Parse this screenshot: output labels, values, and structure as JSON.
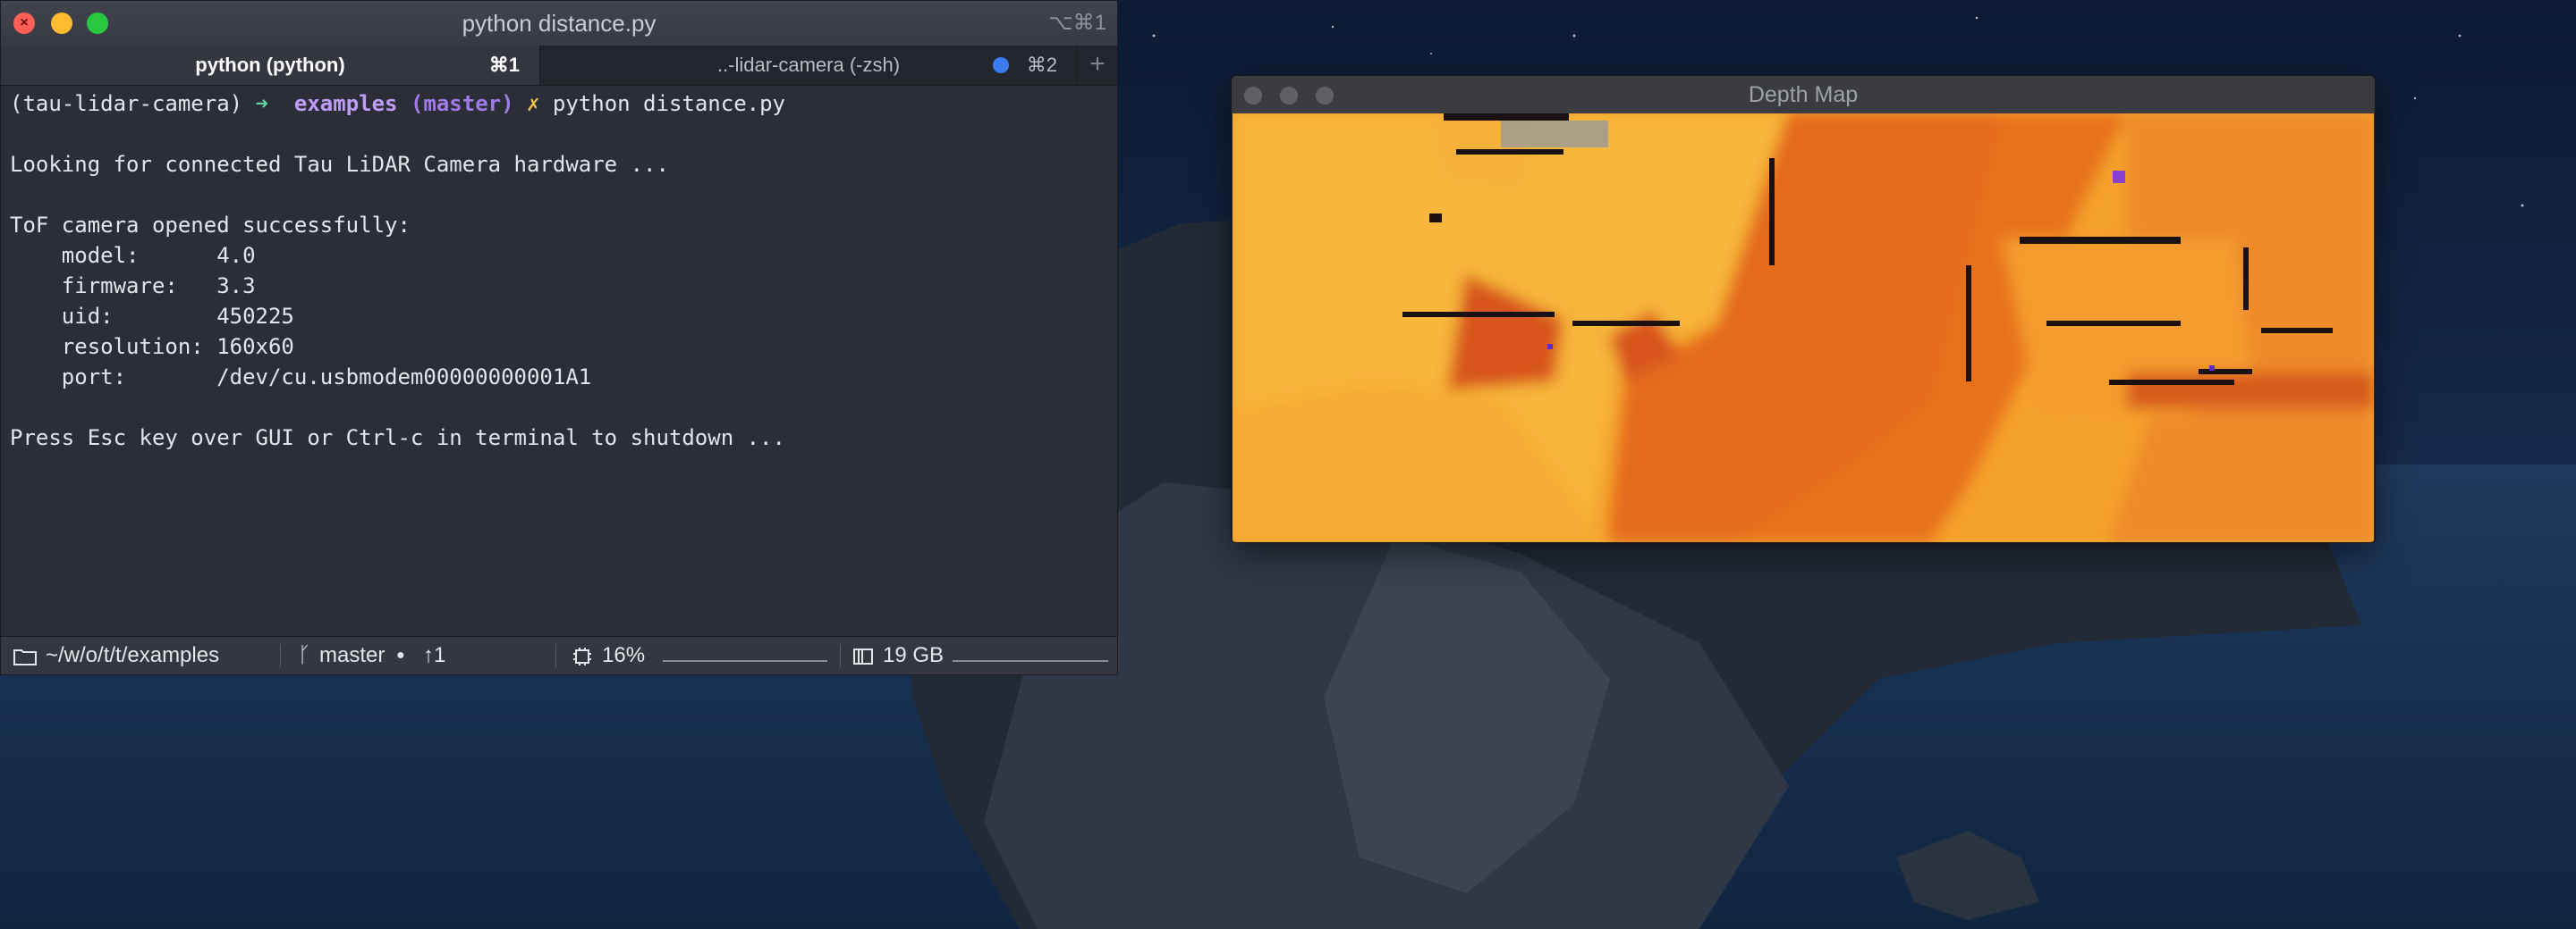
{
  "terminal": {
    "title": "python distance.py",
    "title_shortcut": "⌥⌘1",
    "tabs": [
      {
        "label": "python (python)",
        "shortcut": "⌘1"
      },
      {
        "label": "..-lidar-camera (-zsh)",
        "shortcut": "⌘2"
      }
    ],
    "prompt": {
      "env": "(tau-lidar-camera)",
      "arrow": "➜",
      "dir": "examples",
      "branch": "(master)",
      "mark": "✗",
      "command": "python distance.py"
    },
    "output": {
      "looking": "Looking for connected Tau LiDAR Camera hardware ...",
      "opened": "ToF camera opened successfully:",
      "model": "    model:      4.0",
      "firmware": "    firmware:   3.3",
      "uid": "    uid:        450225",
      "resolution": "    resolution: 160x60",
      "port": "    port:       /dev/cu.usbmodem00000000001A1",
      "shutdown": "Press Esc key over GUI or Ctrl-c in terminal to shutdown ..."
    },
    "status": {
      "path": "~/w/o/t/t/examples",
      "branch": "master",
      "branch_dot": "●",
      "ahead": "↑1",
      "cpu": "16%",
      "disk": "19 GB"
    }
  },
  "depth_window": {
    "title": "Depth Map"
  },
  "icons": {
    "folder": "folder-icon",
    "branch": "git-branch-icon",
    "cpu": "cpu-icon",
    "disk": "disk-icon",
    "add_tab": "plus-icon"
  },
  "colors": {
    "terminal_bg": "#2b2e37",
    "prompt_arrow": "#5fd3a2",
    "repo": "#bf9cf5",
    "mark": "#f0c44a",
    "tab_dot": "#3b7bf0",
    "close": "#ff5f57",
    "minimize": "#febc2e",
    "zoom": "#28c840"
  }
}
